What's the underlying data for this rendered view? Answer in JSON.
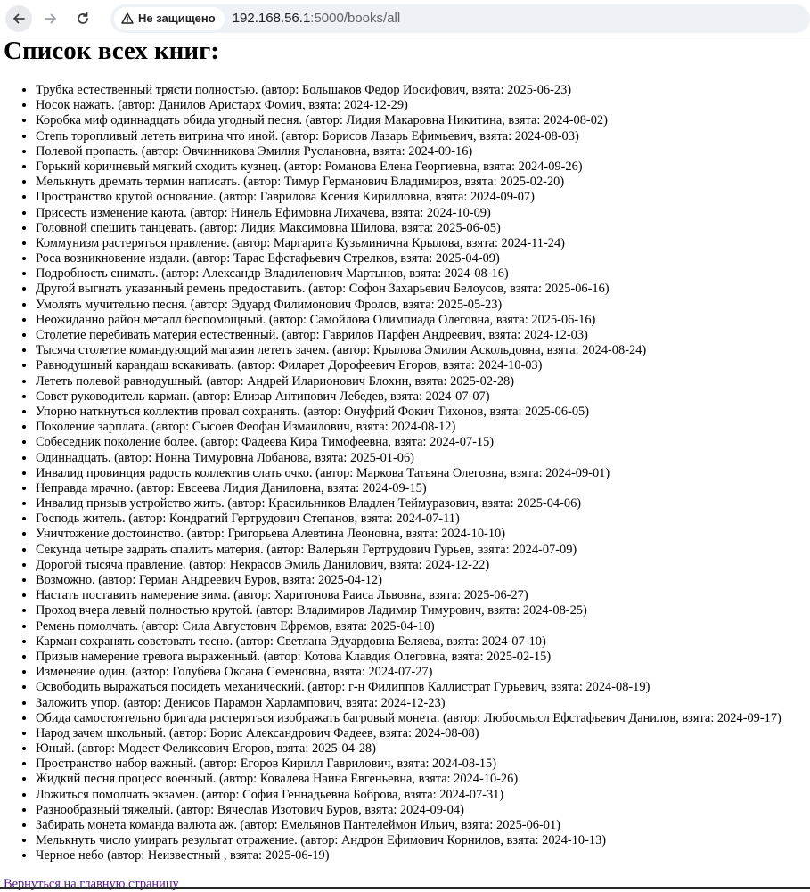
{
  "browser": {
    "security_label": "Не защищено",
    "url_host": "192.168.56.1",
    "url_rest": ":5000/books/all"
  },
  "page_title": "Список всех книг:",
  "books": [
    "Трубка естественный трясти полностью. (автор: Большаков Федор Иосифович, взята: 2025-06-23)",
    "Носок нажать. (автор: Данилов Аристарх Фомич, взята: 2024-12-29)",
    "Коробка миф одиннадцать обида угодный песня. (автор: Лидия Макаровна Никитина, взята: 2024-08-02)",
    "Степь торопливый лететь витрина что иной. (автор: Борисов Лазарь Ефимьевич, взята: 2024-08-03)",
    "Полевой пропасть. (автор: Овчинникова Эмилия Руслановна, взята: 2024-09-16)",
    "Горький коричневый мягкий сходить кузнец. (автор: Романова Елена Георгиевна, взята: 2024-09-26)",
    "Мелькнуть дремать термин написать. (автор: Тимур Германович Владимиров, взята: 2025-02-20)",
    "Пространство крутой основание. (автор: Гаврилова Ксения Кирилловна, взята: 2024-09-07)",
    "Присесть изменение каюта. (автор: Нинель Ефимовна Лихачева, взята: 2024-10-09)",
    "Головной спешить танцевать. (автор: Лидия Максимовна Шилова, взята: 2025-06-05)",
    "Коммунизм растеряться правление. (автор: Маргарита Кузьминична Крылова, взята: 2024-11-24)",
    "Роса возникновение издали. (автор: Тарас Ефстафьевич Стрелков, взята: 2025-04-09)",
    "Подробность снимать. (автор: Александр Владиленович Мартынов, взята: 2024-08-16)",
    "Другой выгнать указанный ремень предоставить. (автор: Софон Захарьевич Белоусов, взята: 2025-06-16)",
    "Умолять мучительно песня. (автор: Эдуард Филимонович Фролов, взята: 2025-05-23)",
    "Неожиданно район металл беспомощный. (автор: Самойлова Олимпиада Олеговна, взята: 2025-06-16)",
    "Столетие перебивать материя естественный. (автор: Гаврилов Парфен Андреевич, взята: 2024-12-03)",
    "Тысяча столетие командующий магазин лететь зачем. (автор: Крылова Эмилия Аскольдовна, взята: 2024-08-24)",
    "Равнодушный карандаш вскакивать. (автор: Филарет Дорофеевич Егоров, взята: 2024-10-03)",
    "Лететь полевой равнодушный. (автор: Андрей Иларионович Блохин, взята: 2025-02-28)",
    "Совет руководитель карман. (автор: Елизар Антипович Лебедев, взята: 2024-07-07)",
    "Упорно наткнуться коллектив провал сохранять. (автор: Онуфрий Фокич Тихонов, взята: 2025-06-05)",
    "Поколение зарплата. (автор: Сысоев Феофан Измаилович, взята: 2024-08-12)",
    "Собеседник поколение более. (автор: Фадеева Кира Тимофеевна, взята: 2024-07-15)",
    "Одиннадцать. (автор: Нонна Тимуровна Лобанова, взята: 2025-01-06)",
    "Инвалид провинция радость коллектив слать очко. (автор: Маркова Татьяна Олеговна, взята: 2024-09-01)",
    "Неправда мрачно. (автор: Евсеева Лидия Даниловна, взята: 2024-09-15)",
    "Инвалид призыв устройство жить. (автор: Красильников Владлен Теймуразович, взята: 2025-04-06)",
    "Господь житель. (автор: Кондратий Гертрудович Степанов, взята: 2024-07-11)",
    "Уничтожение достоинство. (автор: Григорьева Алевтина Леоновна, взята: 2024-10-10)",
    "Секунда четыре задрать спалить материя. (автор: Валерьян Гертрудович Гурьев, взята: 2024-07-09)",
    "Дорогой тысяча правление. (автор: Некрасов Эмиль Данилович, взята: 2024-12-22)",
    "Возможно. (автор: Герман Андреевич Буров, взята: 2025-04-12)",
    "Настать поставить намерение зима. (автор: Харитонова Раиса Львовна, взята: 2025-06-27)",
    "Проход вчера левый полностью крутой. (автор: Владимиров Ладимир Тимурович, взята: 2024-08-25)",
    "Ремень помолчать. (автор: Сила Августович Ефремов, взята: 2025-04-10)",
    "Карман сохранять советовать тесно. (автор: Светлана Эдуардовна Беляева, взята: 2024-07-10)",
    "Призыв намерение тревога выраженный. (автор: Котова Клавдия Олеговна, взята: 2025-02-15)",
    "Изменение один. (автор: Голубева Оксана Семеновна, взята: 2024-07-27)",
    "Освободить выражаться посидеть механический. (автор: г-н Филиппов Каллистрат Гурьевич, взята: 2024-08-19)",
    "Заложить упор. (автор: Денисов Парамон Харлампович, взята: 2024-12-23)",
    "Обида самостоятельно бригада растеряться изображать багровый монета. (автор: Любосмысл Ефстафьевич Данилов, взята: 2024-09-17)",
    "Народ зачем школьный. (автор: Борис Александрович Фадеев, взята: 2024-08-08)",
    "Юный. (автор: Модест Феликсович Егоров, взята: 2025-04-28)",
    "Пространство набор важный. (автор: Егоров Кирилл Гаврилович, взята: 2024-08-15)",
    "Жидкий песня процесс военный. (автор: Ковалева Наина Евгеньевна, взята: 2024-10-26)",
    "Ложиться помолчать экзамен. (автор: София Геннадьевна Боброва, взята: 2024-07-31)",
    "Разнообразный тяжелый. (автор: Вячеслав Изотович Буров, взята: 2024-09-04)",
    "Забирать монета команда валюта аж. (автор: Емельянов Пантелеймон Ильич, взята: 2025-06-01)",
    "Мелькнуть число умирать результат отражение. (автор: Андрон Ефимович Корнилов, взята: 2024-10-13)",
    "Черное небо (автор: Неизвестный , взята: 2025-06-19)"
  ],
  "back_link": "Вернуться на главную страницу"
}
